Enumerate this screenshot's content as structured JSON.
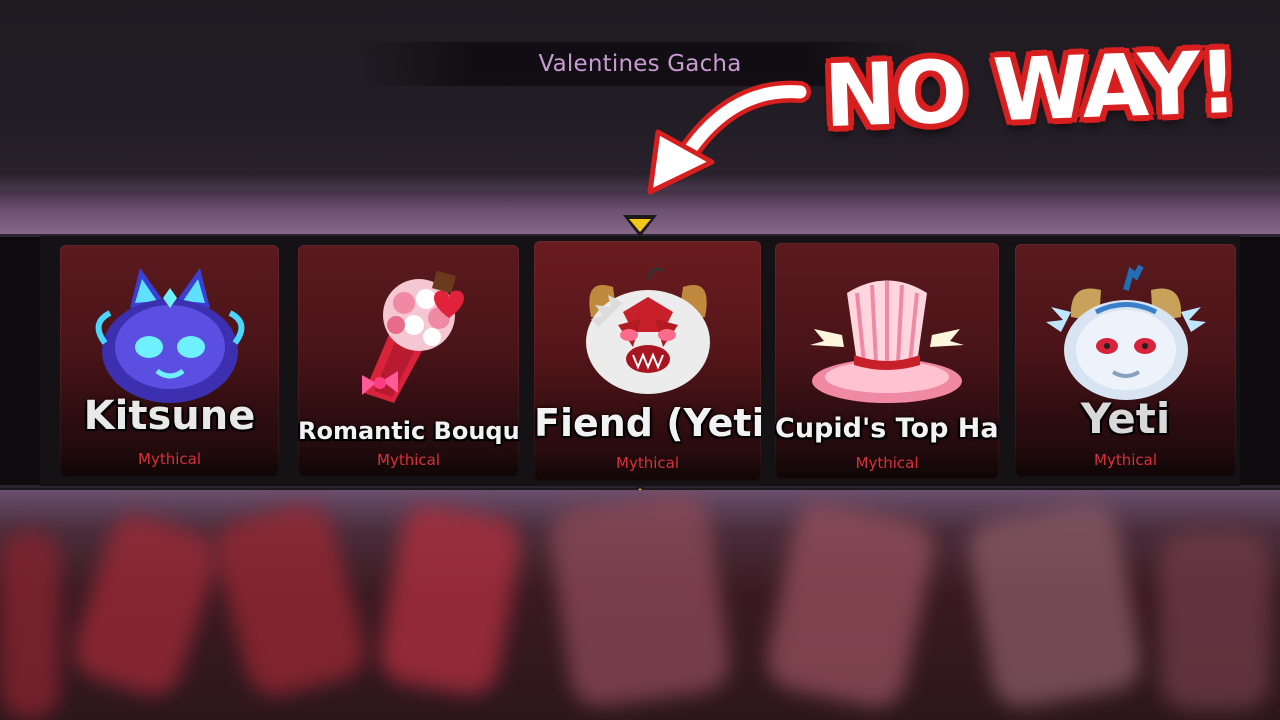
{
  "header": {
    "title": "Valentines Gacha"
  },
  "overlay": {
    "caption": "NO WAY!",
    "caption_color": "#ffffff",
    "caption_outline": "#d81f1f"
  },
  "reel": {
    "selector_color": "#f5c518",
    "items": [
      {
        "name": "Kitsune",
        "rarity": "Mythical",
        "icon": "kitsune-icon"
      },
      {
        "name": "Romantic Bouquet",
        "rarity": "Mythical",
        "icon": "bouquet-icon"
      },
      {
        "name": "Fiend (Yeti)",
        "rarity": "Mythical",
        "icon": "fiend-yeti-icon"
      },
      {
        "name": "Cupid's Top Hat",
        "rarity": "Mythical",
        "icon": "top-hat-icon"
      },
      {
        "name": "Yeti",
        "rarity": "Mythical",
        "icon": "yeti-icon"
      }
    ]
  },
  "colors": {
    "rarity_mythical": "#d8313b",
    "card_red": "#5a1a1e",
    "title_purple": "#c89ad2"
  }
}
